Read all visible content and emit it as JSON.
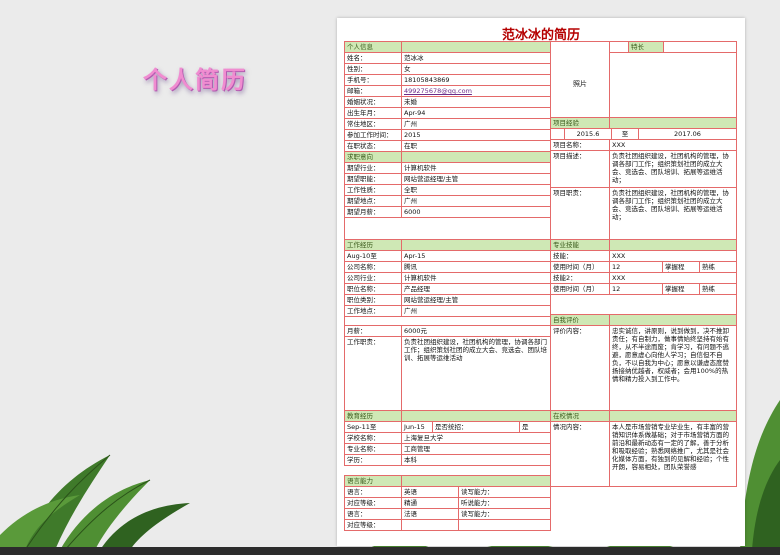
{
  "page": {
    "deco_title": "个人简历"
  },
  "resume": {
    "title": "范冰冰的简历",
    "sections": {
      "personal": "个人信息",
      "job_intent": "求职意向",
      "work_history": "工作经历",
      "education": "教育经历",
      "languages": "语言能力",
      "specialty": "特长",
      "project": "项目经验",
      "skills": "专业技能",
      "self_eval": "自我评价",
      "campus": "在校情况"
    },
    "photo_label": "照片",
    "labels": {
      "name": "姓名：",
      "gender": "性别：",
      "phone": "手机号：",
      "email": "邮箱：",
      "marital": "婚姻状况：",
      "birth": "出生年月：",
      "residence": "常住地区：",
      "work_start": "参加工作时间：",
      "status": "在职状态：",
      "industry": "期望行业：",
      "position": "期望职能：",
      "nature": "工作性质：",
      "location": "期望地点：",
      "salary": "期望月薪：",
      "company": "公司名称：",
      "company_industry": "公司行业：",
      "job_title": "职位名称：",
      "job_type": "职位类别：",
      "work_place": "工作地点：",
      "monthly": "月薪：",
      "duty": "工作职责：",
      "school": "学校名称：",
      "major": "专业名称：",
      "degree": "学历：",
      "language": "语言：",
      "level": "对应等级：",
      "read": "读写能力：",
      "listen": "听说能力：",
      "to": "至",
      "is_unified": "是否统招：",
      "yes": "是",
      "project_name": "项目名称：",
      "project_desc": "项目描述：",
      "project_role": "项目职责：",
      "skill1": "技能：",
      "skill2": "技能2：",
      "use_time": "使用时间（月）",
      "mastery": "掌握程度：",
      "eval_content": "评价内容：",
      "situation": "情况内容："
    },
    "values": {
      "name": "范冰冰",
      "gender": "女",
      "phone": "18105843869",
      "email": "499275678@qq.com",
      "marital": "未婚",
      "birth": "Apr-94",
      "residence": "广州",
      "work_start": "2015",
      "status": "在职",
      "industry": "计算机软件",
      "position": "网站营运经理/主管",
      "nature": "全职",
      "location": "广州",
      "salary": "6000",
      "work_from": "Aug-10",
      "work_to": "Apr-15",
      "company": "腾讯",
      "company_industry": "计算机软件",
      "job_title": "产品经理",
      "job_type": "网站营运经理/主管",
      "work_place": "广州",
      "monthly": "6000元",
      "duty": "负责社团组织建设，社团机构的管理，协调各部门工作；组织策划社团的成立大会、竞选会、团队培训、拓展等运维活动",
      "edu_from": "Sep-11",
      "edu_to": "Jun-15",
      "school": "上海复旦大学",
      "major": "工商管理",
      "degree": "本科",
      "lang1": "英语",
      "lang1_level": "精通",
      "lang2": "法语",
      "lang2_level": "",
      "proj_from": "2015.6",
      "proj_to": "2017.06",
      "project_name": "XXX",
      "project_desc": "负责社团组织建设，社团机构的管理，协调各部门工作；组织策划社团的成立大会、竞选会、团队培训、拓展等运维活动；",
      "project_role": "负责社团组织建设，社团机构的管理，协调各部门工作；组织策划社团的成立大会、竞选会、团队培训、拓展等运维活动；",
      "skill1": "XXX",
      "skill1_time": "12",
      "skill1_mastery": "熟练",
      "skill2": "XXX",
      "skill2_time": "12",
      "skill2_mastery": "熟练",
      "self_eval": "忠实诚信，讲原则，说到做到，决不推卸责任；有自制力，做事情始终坚持有始有终，从不半途而废；肯学习，有问题不逃避，愿意虚心向他人学习；自信但不自负，不以自我为中心；愿意以谦虚态度赞扬接纳优越者，权威者；会用100%的热情和精力投入到工作中。",
      "campus": "本人是市场营销专业毕业生，有丰富的营销知识体系做基础；对于市场营销方面的前沿和最新动态有一定的了解，善于分析和吸取经验；熟悉网络推广，尤其是社会化媒体方面，有独到的见解和经验；个性开朗，容易相处，团队荣誉感"
    }
  }
}
